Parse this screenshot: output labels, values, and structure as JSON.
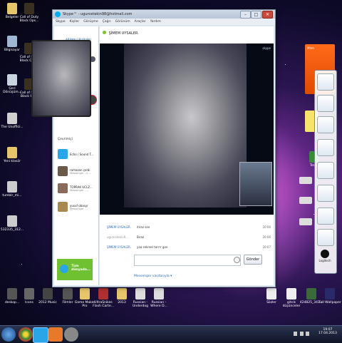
{
  "desktop": {
    "left_icons": [
      {
        "label": "Belgeler",
        "color": "#e7c56a"
      },
      {
        "label": "Call of Duty Black Ops...",
        "color": "#3a3020"
      },
      {
        "label": "Bilgisayar",
        "color": "#9fb7d3"
      },
      {
        "label": "Call of Duty Black Ops...",
        "color": "#3a3020"
      },
      {
        "label": "Geri Dönüşüm...",
        "color": "#c8d5e0"
      },
      {
        "label": "Call of Duty Black Op...",
        "color": "#3a3020"
      },
      {
        "label": "The Unoffici...",
        "color": "#d0d0d0"
      },
      {
        "label": "Yeni klasör",
        "color": "#e7c56a"
      },
      {
        "label": "tumblr_mi...",
        "color": "#cccccc"
      },
      {
        "label": "532335_312...",
        "color": "#cccccc"
      }
    ],
    "bottom_icons": [
      {
        "label": "deskop...",
        "color": "#555"
      },
      {
        "label": "Icons",
        "color": "#666"
      },
      {
        "label": "2012 Music",
        "color": "#444"
      },
      {
        "label": "Filmler",
        "color": "#555"
      },
      {
        "label": "Game Maker Pro",
        "color": "#e7c56a"
      },
      {
        "label": "UltraSnikes Flash Carte...",
        "color": "#b03030"
      },
      {
        "label": "2013",
        "color": "#e7c56a"
      },
      {
        "label": "Russian - Underdog",
        "color": "#ddd"
      },
      {
        "label": "Russian - Where D...",
        "color": "#ddd"
      },
      {
        "label": "Sözler",
        "color": "#eee"
      },
      {
        "label": "gitcik düşünceler",
        "color": "#eee"
      },
      {
        "label": "424825_343...",
        "color": "#3a6a3a"
      },
      {
        "label": "Fall Wallpaper",
        "color": "#2a2a6a"
      }
    ],
    "right_icons": [
      {
        "label": "Temp",
        "color": "#3a8a3a"
      }
    ]
  },
  "skype_window": {
    "title": "Skype™ - ugurcetekin98@hotmail.com",
    "menu": [
      "Skype",
      "Kişiler",
      "Görüşme",
      "Çağrı",
      "Görünüm",
      "Araçlar",
      "Yardım"
    ],
    "profile_status_label": "ARAMA GRUBUNU",
    "contacts_header": "Çevrimiçi",
    "contacts": [
      {
        "name": "Echo / Sound T...",
        "status": "",
        "color": "#2aa6e8"
      },
      {
        "name": "ramazan çelik",
        "status": "Messenger - Ç...",
        "color": "#6b5a4a"
      },
      {
        "name": "TOPRAK UCLZ...",
        "status": "Messenger - ...",
        "color": "#8a6a5a"
      },
      {
        "name": "yusuf obasyr",
        "status": "Messenger - ...",
        "color": "#a88a50"
      }
    ],
    "promo_text": "Tüm dünyada...",
    "chat_title": "ŞİMEM UYSALER.",
    "video_badge": "skype",
    "messages": [
      {
        "who": "ŞİMEM UYSALER.",
        "text": "itiraz sen",
        "time": "20:06"
      },
      {
        "who": "ugurcetekin9...",
        "text": "Bıraz",
        "time": "20:06"
      },
      {
        "who": "ŞİMEM UYSALER.",
        "text": "yaa sekreel terrrr gon",
        "time": "20:07"
      }
    ],
    "send_button": "Gönder",
    "input_placeholder": "",
    "footer_link": "Messenger vasıtasıyla ▾"
  },
  "gadget_panel": {
    "items": [
      "person-icon",
      "calendar-icon",
      "people-icon",
      "screen-icon",
      "gears-icon",
      "network-icon",
      "help-icon",
      "tools-icon",
      "logitech-icon"
    ],
    "logitech_label": "Logitech",
    "orange_widget_label": "Mhm"
  },
  "taskbar": {
    "apps": [
      "windows-orb",
      "chrome-icon",
      "skype-icon",
      "media-player-icon",
      "webcam-icon"
    ],
    "time": "19:07",
    "date": "17.04.2013"
  }
}
